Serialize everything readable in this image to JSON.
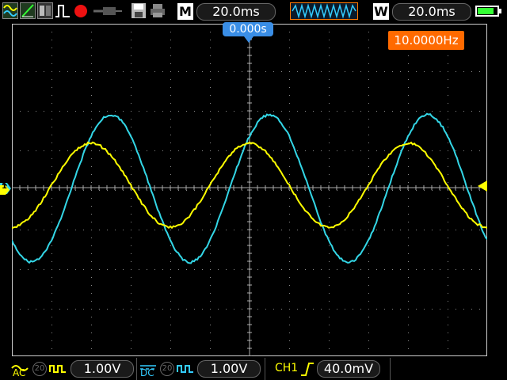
{
  "toolbar": {
    "icons": [
      "yellow-wave-icon",
      "ramp-icon",
      "measure-icon",
      "pulse-icon",
      "record-icon",
      "probe-icon",
      "save-icon",
      "print-icon"
    ],
    "mode_label": "M",
    "main_timebase": "20.0ms",
    "window_label": "W",
    "window_timebase": "20.0ms"
  },
  "screen": {
    "trigger_position": "0.000s",
    "frequency": "10.0000Hz",
    "ch1_marker": "1",
    "ch2_marker": "2",
    "colors": {
      "ch1": "#ffff00",
      "ch2": "#33d6e6",
      "grid": "#8a8a8a",
      "frequency_bg": "#ff6a00"
    }
  },
  "bottom": {
    "ch1_coupling": "AC",
    "ch1_bw": "20",
    "ch1_volts": "1.00V",
    "ch2_coupling": "DC",
    "ch2_bw": "20",
    "ch2_volts": "1.00V",
    "trigger_source": "CH1",
    "trigger_level": "40.0mV"
  }
}
